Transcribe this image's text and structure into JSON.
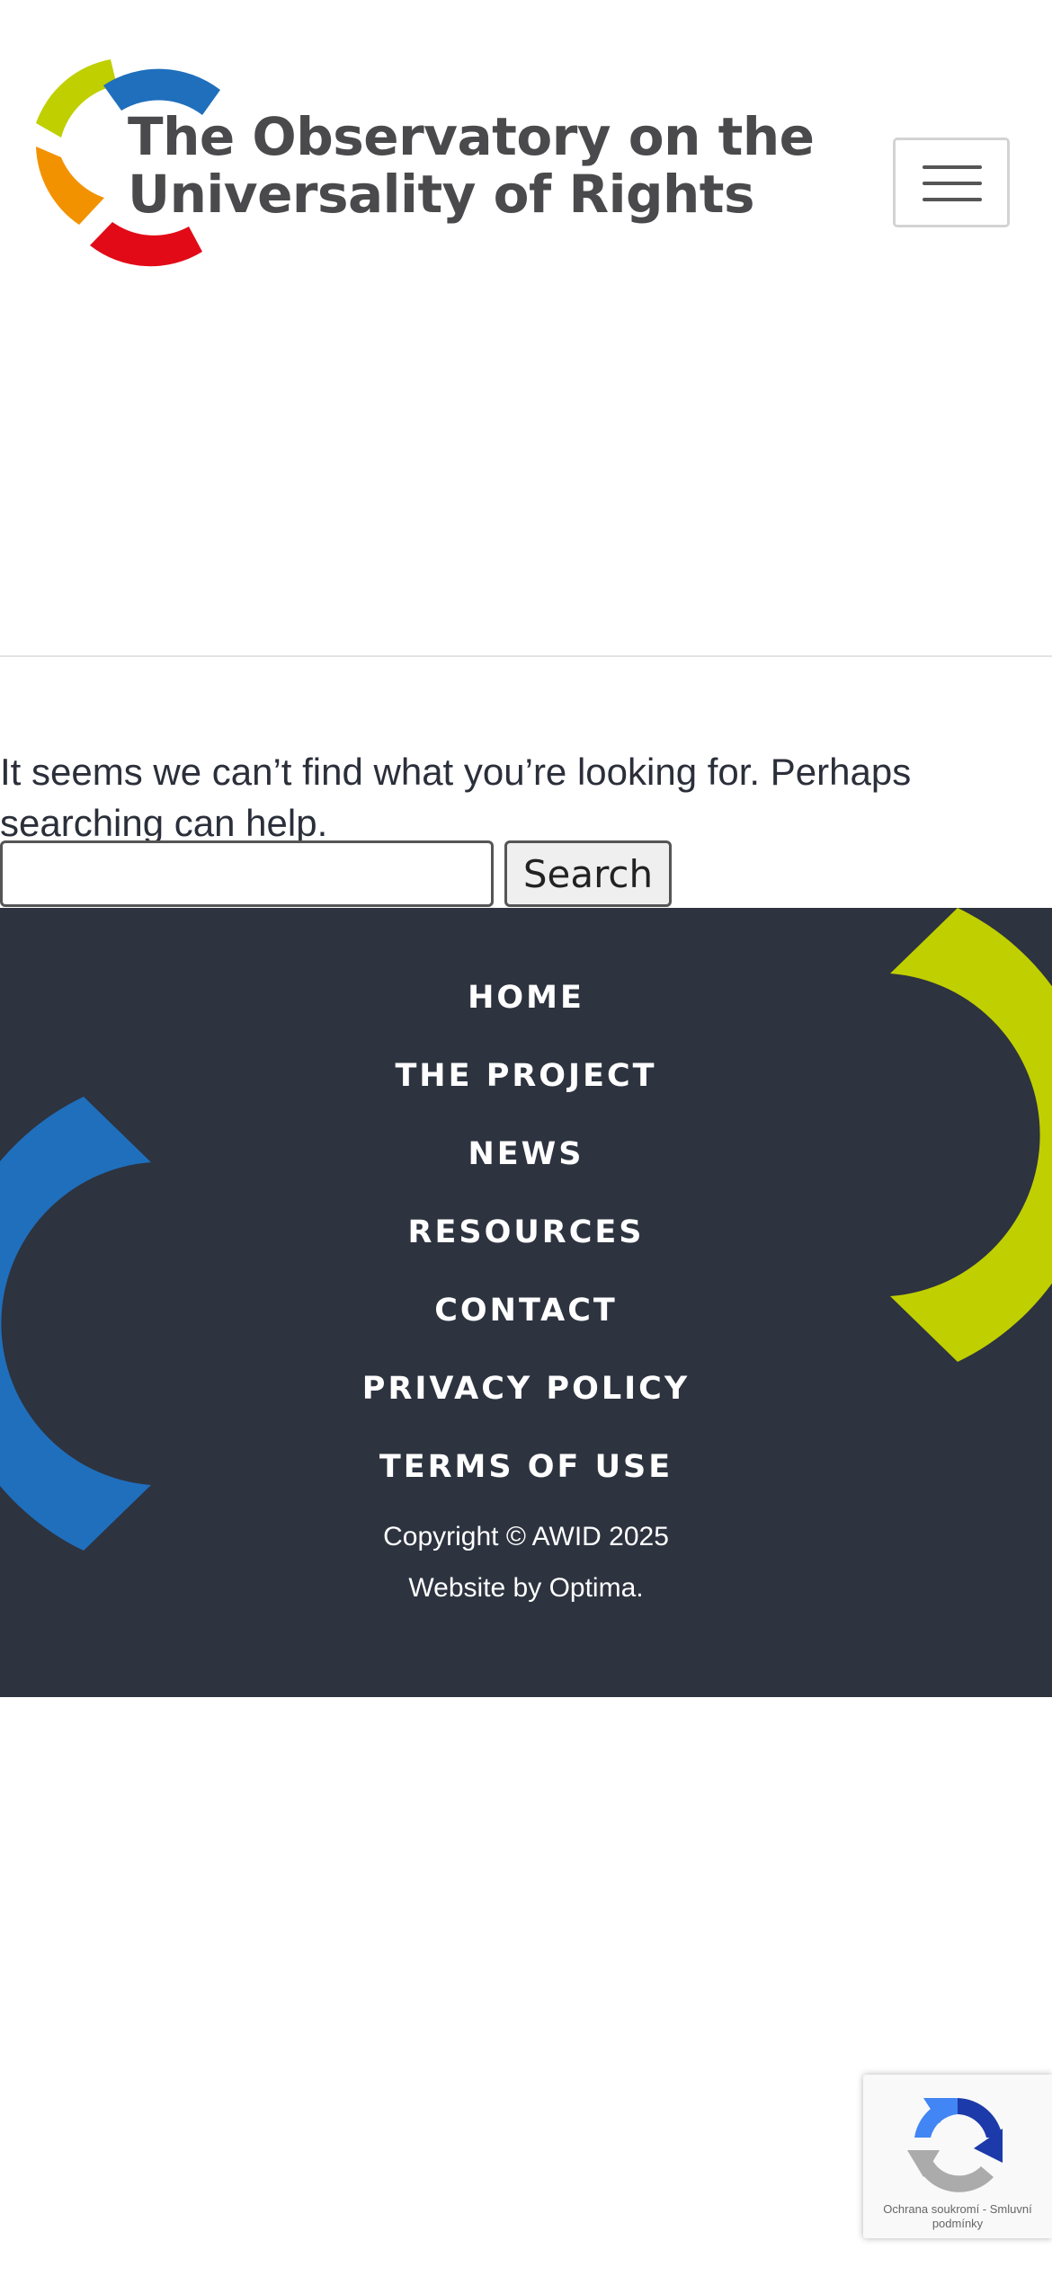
{
  "header": {
    "logo_line1": "The Observatory on the",
    "logo_line2": "Universality of Rights",
    "menu_icon": "hamburger-menu-icon"
  },
  "main": {
    "message": "It seems we can’t find what you’re looking for. Perhaps searching can help.",
    "search": {
      "value": "",
      "button_label": "Search"
    }
  },
  "footer": {
    "nav": [
      "HOME",
      "THE PROJECT",
      "NEWS",
      "RESOURCES",
      "CONTACT",
      "PRIVACY POLICY",
      "TERMS OF USE"
    ],
    "copyright": "Copyright © AWID 2025",
    "credit": "Website by Optima."
  },
  "recaptcha": {
    "links": "Ochrana soukromí - Smluvní podmínky",
    "icon": "recaptcha-logo-icon"
  },
  "colors": {
    "footer_bg": "#2d333f",
    "brand_lime": "#c0cf00",
    "brand_blue": "#1f6fbd",
    "brand_orange": "#f39200",
    "brand_red": "#e20a17"
  }
}
